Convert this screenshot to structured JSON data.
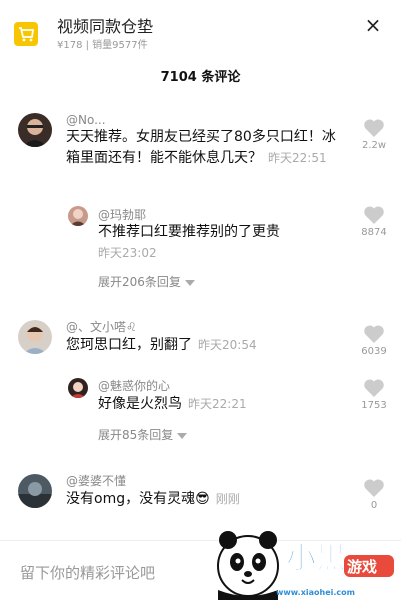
{
  "product": {
    "title": "视频同款仓垫",
    "meta": "¥178 | 销量9577件",
    "close_label": "×"
  },
  "header": {
    "comment_count": "7104 条评论"
  },
  "comments": [
    {
      "username": "@No...",
      "text": "天天推荐。女朋友已经买了80多只口红！冰箱里面还有！能不能休息几天？",
      "time": "昨天22:51",
      "likes": "2.2w",
      "replies": [
        {
          "username": "@玛勃耶",
          "text": "不推荐口红要推荐别的了更贵",
          "time": "昨天23:02",
          "likes": "8874",
          "expand": "展开206条回复"
        }
      ]
    },
    {
      "username": "@、文小嗒♌",
      "text": "您珂思口红，别翻了",
      "time": "昨天20:54",
      "likes": "6039",
      "replies": [
        {
          "username": "@魅惑你的心",
          "text": "好像是火烈鸟",
          "time": "昨天22:21",
          "likes": "1753",
          "expand": "展开85条回复"
        }
      ]
    },
    {
      "username": "@婆婆不懂",
      "text": "没有omg，没有灵魂😎",
      "time": "刚刚",
      "likes": "0"
    }
  ],
  "input": {
    "placeholder": "留下你的精彩评论吧"
  },
  "watermark": {
    "brand": "小黑游戏",
    "url": "www.xiaohei.com"
  },
  "colors": {
    "accent": "#f7c600",
    "muted": "#999999"
  }
}
